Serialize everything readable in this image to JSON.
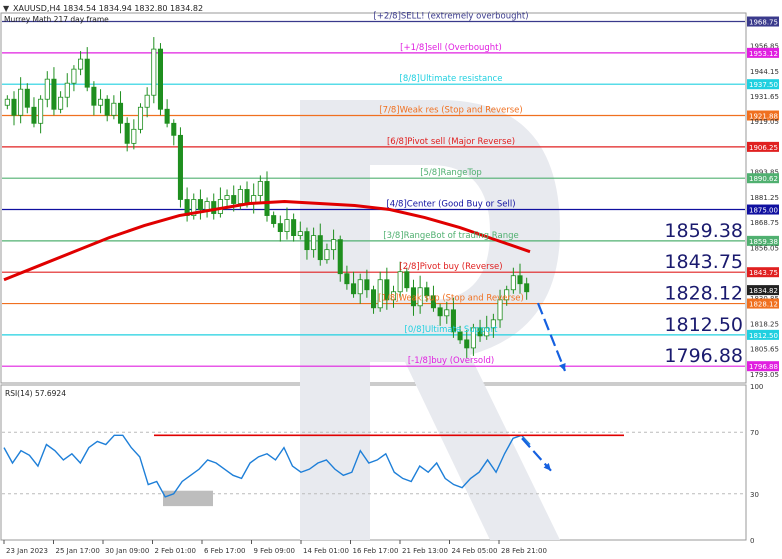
{
  "header": {
    "symbol_line": "XAUUSD,H4  1834.54 1834.94 1832.80 1834.82",
    "indicator_label": "Murrey Math 217 day frame"
  },
  "rsi_panel": {
    "label": "RSI(14) 57.6924"
  },
  "colors": {
    "candle": "#1f8f1f",
    "moving_average": "#e00000",
    "rsi_line": "#1e7fd8",
    "arrow": "#1560e0",
    "oversold_box": "#bdbdbd"
  },
  "chart_data": [
    {
      "type": "candlestick",
      "title": "XAUUSD,H4",
      "ylim": [
        1788.5,
        1973.0
      ],
      "y_ticks": [
        "1968.75",
        "1956.85",
        "1953.12",
        "1944.15",
        "1937.50",
        "1931.65",
        "1921.88",
        "1919.05",
        "1906.25",
        "1893.85",
        "1890.62",
        "1881.25",
        "1875.00",
        "1868.75",
        "1859.38",
        "1856.05",
        "1843.75",
        "1834.82",
        "1830.85",
        "1828.12",
        "1818.25",
        "1812.50",
        "1805.65",
        "1796.88",
        "1793.05"
      ],
      "highlighted_ticks": [
        {
          "label": "1968.75",
          "color": "#3a3a8c"
        },
        {
          "label": "1953.12",
          "color": "#e020e0"
        },
        {
          "label": "1937.50",
          "color": "#20d0e0"
        },
        {
          "label": "1921.88",
          "color": "#f07020"
        },
        {
          "label": "1906.25",
          "color": "#e02020"
        },
        {
          "label": "1890.62",
          "color": "#50b070"
        },
        {
          "label": "1875.00",
          "color": "#1010a0"
        },
        {
          "label": "1859.38",
          "color": "#50b070"
        },
        {
          "label": "1843.75",
          "color": "#e02020"
        },
        {
          "label": "1834.82",
          "color": "#222222"
        },
        {
          "label": "1828.12",
          "color": "#f07020"
        },
        {
          "label": "1812.50",
          "color": "#20d0e0"
        },
        {
          "label": "1796.88",
          "color": "#e020e0"
        }
      ],
      "x_ticks": [
        "23 Jan 2023",
        "25 Jan 17:00",
        "30 Jan 09:00",
        "2 Feb 01:00",
        "6 Feb 17:00",
        "9 Feb 09:00",
        "14 Feb 01:00",
        "16 Feb 17:00",
        "21 Feb 13:00",
        "24 Feb 05:00",
        "28 Feb 21:00"
      ],
      "murrey_levels": [
        {
          "value": 1968.75,
          "label": "[+2/8]SELL! (extremely overbought)",
          "color": "#3a3a8c"
        },
        {
          "value": 1953.12,
          "label": "[+1/8]sell (Overbought)",
          "color": "#e020e0"
        },
        {
          "value": 1937.5,
          "label": "[8/8]Ultimate resistance",
          "color": "#20d0e0"
        },
        {
          "value": 1921.88,
          "label": "[7/8]Weak res (Stop and Reverse)",
          "color": "#f07020"
        },
        {
          "value": 1906.25,
          "label": "[6/8]Pivot sell (Major Reverse)",
          "color": "#e02020"
        },
        {
          "value": 1890.62,
          "label": "[5/8]RangeTop",
          "color": "#50b070"
        },
        {
          "value": 1875.0,
          "label": "[4/8]Center (Good Buy or Sell)",
          "color": "#1010a0"
        },
        {
          "value": 1859.38,
          "label": "[3/8]RangeBot of trading Range",
          "color": "#50b070"
        },
        {
          "value": 1843.75,
          "label": "[2/8]Pivot buy (Reverse)",
          "color": "#e02020"
        },
        {
          "value": 1828.12,
          "label": "[1/8]Weak sup (Stop and Reverse)",
          "color": "#f07020"
        },
        {
          "value": 1812.5,
          "label": "[0/8]Ultimate Support",
          "color": "#20d0e0"
        },
        {
          "value": 1796.88,
          "label": "[-1/8]buy (Oversold)",
          "color": "#e020e0"
        }
      ],
      "big_labels": [
        "1859.38",
        "1843.75",
        "1828.12",
        "1812.50",
        "1796.88"
      ],
      "close_path": [
        1930,
        1922,
        1935,
        1926,
        1918,
        1930,
        1940,
        1925,
        1931,
        1938,
        1945,
        1950,
        1936,
        1927,
        1930,
        1922,
        1928,
        1918,
        1908,
        1915,
        1926,
        1932,
        1955,
        1925,
        1918,
        1912,
        1880,
        1872,
        1880,
        1875,
        1879,
        1873,
        1880,
        1882,
        1878,
        1885,
        1878,
        1882,
        1889,
        1872,
        1868,
        1864,
        1870,
        1862,
        1864,
        1855,
        1862,
        1850,
        1855,
        1860,
        1843,
        1838,
        1833,
        1840,
        1835,
        1826,
        1840,
        1830,
        1834,
        1844,
        1836,
        1827,
        1836,
        1832,
        1826,
        1822,
        1825,
        1814,
        1810,
        1806,
        1816,
        1812,
        1816,
        1820,
        1830,
        1835,
        1842,
        1838,
        1834
      ],
      "moving_average": [
        1840,
        1847,
        1854,
        1861,
        1867,
        1872,
        1875,
        1878,
        1879,
        1878,
        1877,
        1875,
        1871,
        1866,
        1860,
        1854
      ],
      "forecast": {
        "from": 1834.82,
        "to": 1794.5
      }
    },
    {
      "type": "line",
      "title": "RSI(14) 57.6924",
      "ylim": [
        0,
        100
      ],
      "y_ticks": [
        "100",
        "70",
        "30",
        "0"
      ],
      "levels": [
        70,
        30
      ],
      "rsi_values": [
        60,
        50,
        58,
        55,
        48,
        62,
        58,
        52,
        56,
        50,
        60,
        64,
        62,
        68,
        68,
        60,
        54,
        36,
        38,
        28,
        30,
        38,
        42,
        46,
        52,
        50,
        46,
        42,
        40,
        50,
        54,
        56,
        52,
        60,
        48,
        44,
        46,
        50,
        52,
        46,
        42,
        44,
        58,
        50,
        52,
        56,
        44,
        40,
        38,
        48,
        44,
        50,
        40,
        36,
        34,
        40,
        44,
        52,
        44,
        56,
        66,
        68,
        62
      ],
      "resistance_line_value": 68,
      "forecast": {
        "from": 68,
        "to": 45
      }
    }
  ]
}
